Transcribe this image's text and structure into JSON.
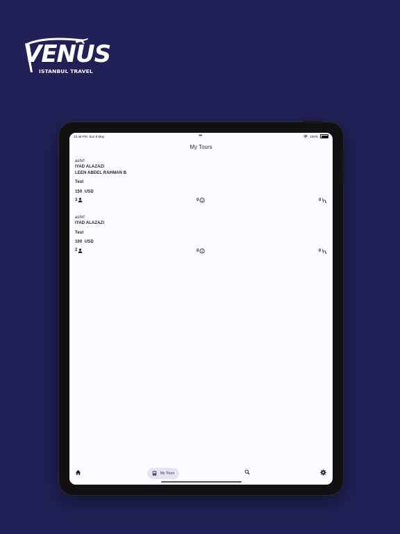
{
  "logo": {
    "brand": "VENUS",
    "tagline": "ISTANBUL TRAVEL",
    "icon": "airplane-icon"
  },
  "status_bar": {
    "time": "12:46 PM",
    "date": "Sun 5 May",
    "battery": "100%",
    "icons": [
      "wifi-icon",
      "battery-icon"
    ]
  },
  "header": {
    "title": "My Tours"
  },
  "tours": [
    {
      "guide": "ashrf",
      "guests": [
        "IYAD ALAZAZI",
        "LEEN ABDEL RAHMAN B"
      ],
      "note": "Test",
      "price": "150",
      "currency": "USD",
      "people_count": "3",
      "middle_count": "0",
      "right_count": "0"
    },
    {
      "guide": "ashrf",
      "guests": [
        "IYAD ALAZAZI"
      ],
      "note": "Test",
      "price": "100",
      "currency": "USD",
      "people_count": "2",
      "middle_count": "0",
      "right_count": "0"
    }
  ],
  "bottom_nav": {
    "items": [
      {
        "icon": "home-icon",
        "label": ""
      },
      {
        "icon": "bus-icon",
        "label": "My Tours",
        "active": true
      },
      {
        "icon": "search-icon",
        "label": ""
      },
      {
        "icon": "gear-icon",
        "label": ""
      }
    ]
  },
  "colors": {
    "background": "#212157",
    "screen": "#fcfbff",
    "active_tab": "#e6e4f4"
  }
}
